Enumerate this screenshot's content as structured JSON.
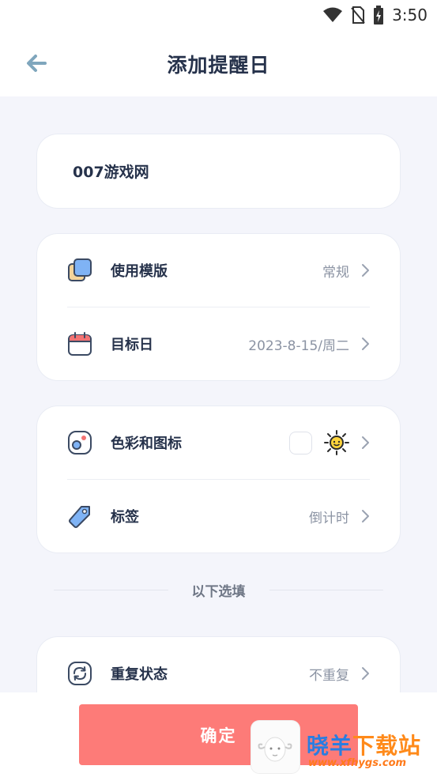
{
  "status_bar": {
    "time": "3:50"
  },
  "header": {
    "title": "添加提醒日"
  },
  "name": {
    "value": "007游戏网"
  },
  "settings": {
    "template": {
      "label": "使用模版",
      "value": "常规"
    },
    "target_date": {
      "label": "目标日",
      "value": "2023-8-15/周二"
    },
    "color_icon": {
      "label": "色彩和图标",
      "swatch_color": "#ffffff",
      "icon": "sun-icon"
    },
    "tag": {
      "label": "标签",
      "value": "倒计时"
    }
  },
  "optional_divider": "以下选填",
  "repeat": {
    "label": "重复状态",
    "value": "不重复"
  },
  "confirm_button": "确定",
  "watermark": {
    "text_a": "晓羊",
    "text_b": "下载站",
    "url": "www.xfhygs.com"
  },
  "colors": {
    "accent": "#fd7b78",
    "text": "#26324b",
    "muted": "#8b93a3",
    "background": "#f4f5fb"
  }
}
